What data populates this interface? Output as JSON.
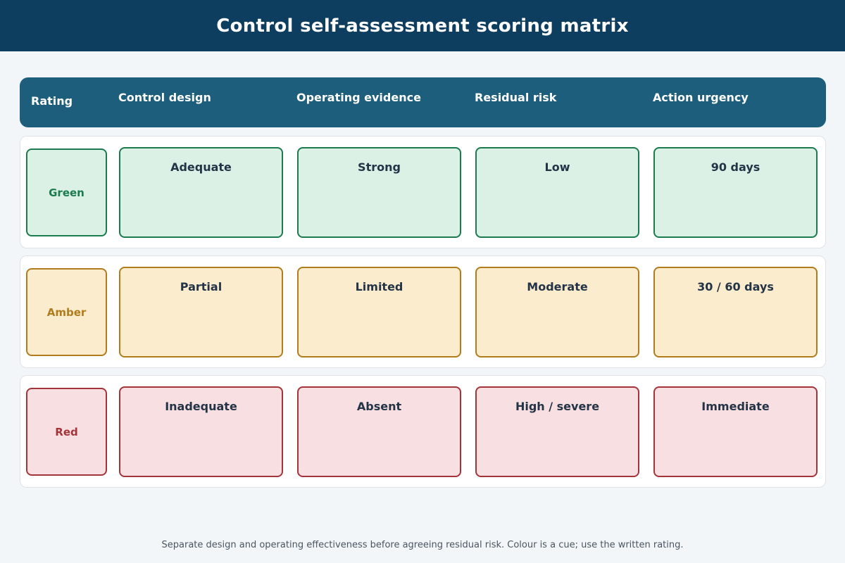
{
  "title": "Control self-assessment scoring matrix",
  "columns": {
    "rating": "Rating",
    "design": "Control design",
    "evidence": "Operating evidence",
    "risk": "Residual risk",
    "urgency": "Action urgency"
  },
  "rows": [
    {
      "rating": "Green",
      "design": "Adequate",
      "evidence": "Strong",
      "risk": "Low",
      "urgency": "90 days",
      "colors": {
        "fill": "#dcf1e6",
        "border": "#1b7a4e"
      }
    },
    {
      "rating": "Amber",
      "design": "Partial",
      "evidence": "Limited",
      "risk": "Moderate",
      "urgency": "30 / 60 days",
      "colors": {
        "fill": "#fcecce",
        "border": "#b07c1c"
      }
    },
    {
      "rating": "Red",
      "design": "Inadequate",
      "evidence": "Absent",
      "risk": "High / severe",
      "urgency": "Immediate",
      "colors": {
        "fill": "#f8dfe1",
        "border": "#a3343a"
      }
    }
  ],
  "footer": "Separate design and operating effectiveness before agreeing residual risk. Colour is a cue; use the written rating.",
  "colors": {
    "title_bar": "#0d3d5f",
    "header_row": "#1c5e7b",
    "background": "#f3f6f9"
  }
}
